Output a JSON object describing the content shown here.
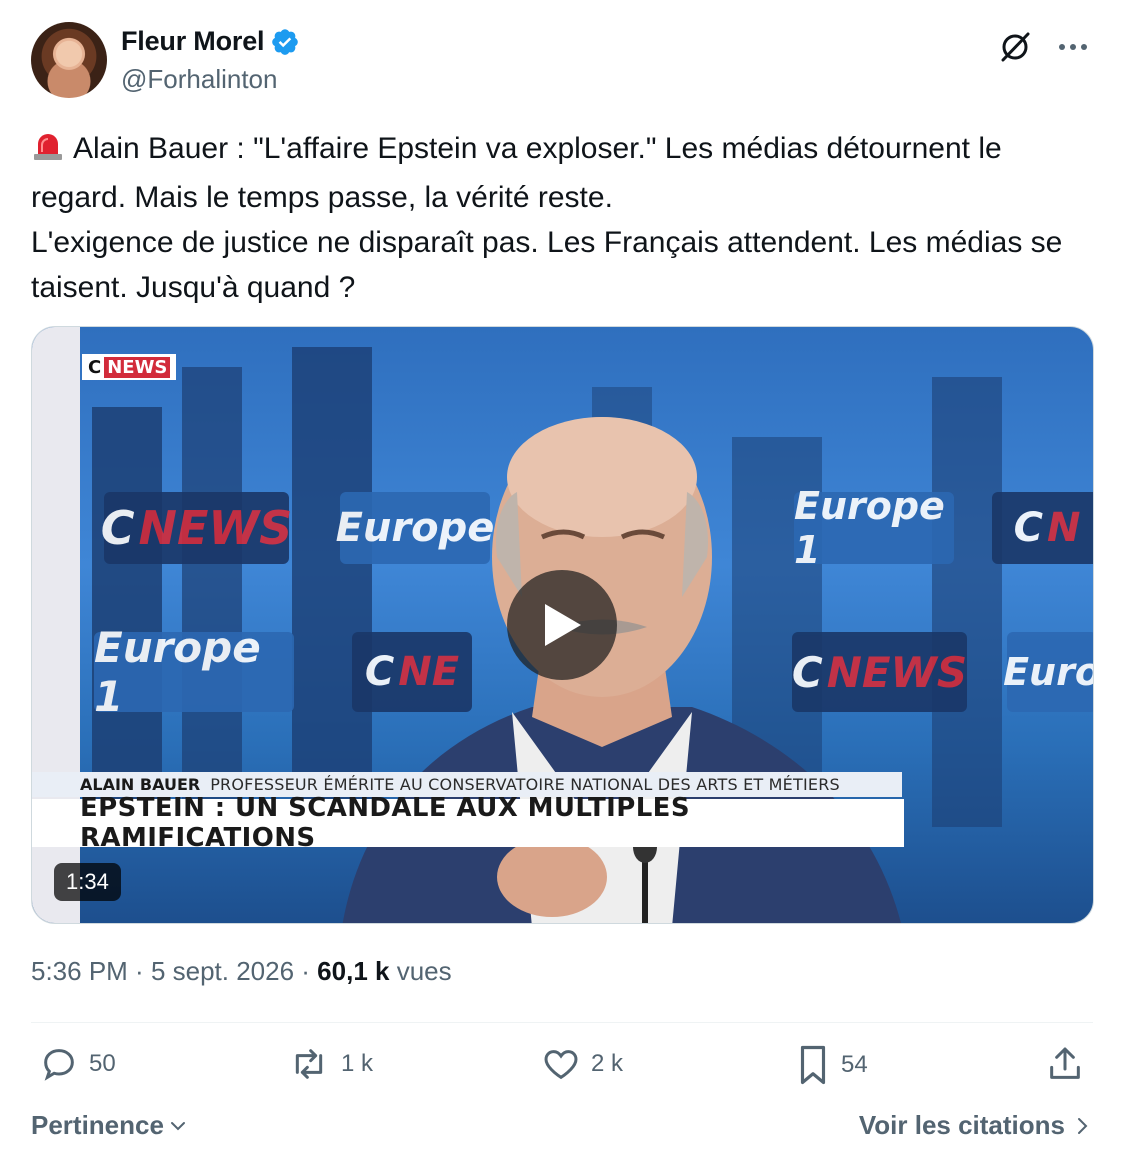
{
  "author": {
    "name": "Fleur Morel",
    "handle": "@Forhalinton"
  },
  "icons": {
    "verified": "verified-badge-icon",
    "grok": "grok-icon",
    "more": "more-icon",
    "siren": "rotating-light-emoji",
    "reply": "reply-icon",
    "repost": "repost-icon",
    "like": "heart-icon",
    "bookmark": "bookmark-icon",
    "share": "share-icon",
    "play": "play-icon"
  },
  "tweet": {
    "line1": "Alain Bauer : \"L'affaire Epstein va exploser.\" Les médias détournent le regard. Mais le temps passe, la vérité reste.",
    "line2": "L'exigence de justice ne disparaît pas. Les Français attendent. Les médias se taisent. Jusqu'à quand ?"
  },
  "video": {
    "channel_logo_c": "C",
    "channel_logo_news": "NEWS",
    "panel_cnews_c": "C",
    "panel_cnews_news": "NEWS",
    "panel_europe": "Europe",
    "panel_europe1": "Europe 1",
    "speaker_name": "ALAIN BAUER",
    "speaker_title": "PROFESSEUR ÉMÉRITE AU CONSERVATOIRE NATIONAL DES ARTS ET MÉTIERS",
    "headline": "EPSTEIN : UN SCANDALE AUX MULTIPLES RAMIFICATIONS",
    "duration": "1:34"
  },
  "meta": {
    "time": "5:36 PM",
    "sep": " · ",
    "date": "5 sept. 2026",
    "views_count": "60,1 k",
    "views_label": "vues"
  },
  "actions": {
    "replies": "50",
    "reposts": "1 k",
    "likes": "2 k",
    "bookmarks": "54"
  },
  "footer": {
    "sort_label": "Pertinence",
    "quotes_label": "Voir les citations"
  },
  "colors": {
    "text": "#0f1419",
    "secondary": "#536471",
    "verified": "#1d9bf0",
    "border": "#cfd9de"
  }
}
